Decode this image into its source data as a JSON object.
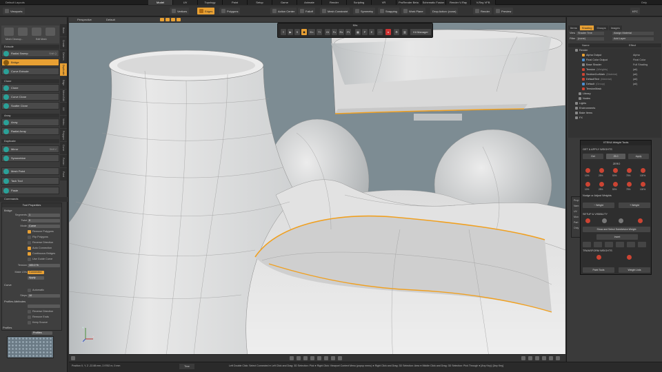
{
  "title": {
    "layout": "Default Layouts",
    "only": "Only"
  },
  "menu_tabs": [
    {
      "label": "Model",
      "active": true
    },
    {
      "label": "UV"
    },
    {
      "label": "Topology"
    },
    {
      "label": "Paint"
    },
    {
      "label": "Setup"
    },
    {
      "label": "Game"
    },
    {
      "label": "Animate"
    },
    {
      "label": "Render"
    },
    {
      "label": "Scripting"
    },
    {
      "label": "VR"
    },
    {
      "label": "ProRender Beta"
    },
    {
      "label": "Schematic Fusion"
    },
    {
      "label": "Render V-Ray"
    },
    {
      "label": "V-Ray VFB"
    }
  ],
  "toolbar": {
    "viewport": "Viewports",
    "vertices": "Vertices",
    "edges": "Edges",
    "polygons": "Polygons",
    "action_center": "Action Center",
    "falloff": "Falloff",
    "mesh_constraint": "Mesh Constraint",
    "symmetry": "Symmetry",
    "snapping": "Snapping",
    "work_plane": "Work Plane",
    "drop_action": "Drop Action: (none)",
    "render": "Render",
    "preview": "Preview",
    "kfc": "KFC"
  },
  "left_panel": {
    "vtabs": [
      "Basic",
      "Create",
      "Deform",
      "Duplicate",
      "Edge",
      "Mesh Edit",
      "UV",
      "Vertex",
      "Polygon",
      "Curve",
      "Fusion",
      "Paint"
    ],
    "mesh_labels": [
      "Mesh Cleanup...",
      "Edit Mesh"
    ],
    "sections": {
      "extrude": "Extrude",
      "clone": "Clone",
      "array": "Array",
      "duplicate": "Duplicate",
      "commands": "Commands"
    },
    "tools": {
      "radial_sweep": "Radial Sweep",
      "bridge": "Bridge",
      "curve_extrude": "Curve Extrude",
      "clone": "Clone",
      "curve_clone": "Curve Clone",
      "scatter_clone": "Scatter Clone",
      "array": "Array",
      "radial_array": "Radial Array",
      "mirror": "Mirror",
      "symmetrize": "Symmetrize",
      "mesh_paint": "Mesh Paint",
      "tack_tool": "Tack Tool",
      "paste": "Paste"
    },
    "hints": {
      "radial_sweep": "Shift Q",
      "mirror": "Shift V"
    }
  },
  "tool_properties": {
    "title": "Tool Properties",
    "section": "Bridge",
    "segments_label": "Segments",
    "segments": "1",
    "twist_label": "Twist",
    "twist": "0",
    "mode_label": "Mode",
    "mode": "Curve",
    "remove_polygons": "Remove Polygons",
    "flip_polygons": "Flip Polygons",
    "reverse_direction": "Reverse Direction",
    "auto_connection": "Auto Connection",
    "continuous_bridges": "Continuous Bridges",
    "use_guide_curve": "Use Guide Curve",
    "tension_label": "Tension",
    "tension": "100.0 %",
    "make_uvs_label": "Make UVs",
    "make_uvs": "Connected",
    "apply": "Apply",
    "curve_section": "Curve",
    "automatic": "Automatic",
    "steps_label": "Steps",
    "steps": "10",
    "profiles_attr": "Profiles Attributes",
    "reverse_direction2": "Reverse Direction",
    "remove_ends": "Remove Ends",
    "keep_source": "Keep Source",
    "profiles": "Profiles",
    "profiles_dd": "Profiles"
  },
  "viewport": {
    "view_name": "Perspective",
    "style": "Default",
    "kit_title": "Kits",
    "kit_buttons": [
      "S",
      "En",
      "TI",
      "GI",
      "Fc",
      "Rx",
      "Pt",
      "P",
      "E"
    ],
    "kit_manager": "Kit Manager",
    "axis": {
      "x": "X",
      "y": "Y",
      "z": "Z"
    }
  },
  "statusbar": {
    "position": "Position X, Y, Z    -22.88 mm, 2.9762 m, 0 mm",
    "time": "Time",
    "hint": "Left Double Click: Select Connected ● Left Click and Drag: 3D Selection: Pick ● Right Click: Viewport Context Menu (popup menu) ● Right Click and Drag: 3D Selection: Area ● Middle Click and Drag: 3D Selection: Pick Through ● [Any Key]: [Any Key]"
  },
  "right_panel": {
    "tabs": [
      "Items",
      "Shading",
      "Groups",
      "Images"
    ],
    "active_tab": "Shading",
    "view_label": "View",
    "view_value": "Shader Tree",
    "assign_material": "Assign Material",
    "filter_label": "Filter",
    "filter_value": "(none)",
    "add_layer": "Add Layer",
    "col_name": "Name",
    "col_effect": "Effect",
    "tree": [
      {
        "name": "Render",
        "effect": "",
        "indent": 0
      },
      {
        "name": "Alpha Output",
        "effect": "Alpha",
        "indent": 2
      },
      {
        "name": "Final Color Output",
        "effect": "Final Color",
        "indent": 2
      },
      {
        "name": "Base Shader",
        "effect": "Full Shading",
        "indent": 2
      },
      {
        "name": "Tension",
        "sub": "(Weights)",
        "effect": "(all)",
        "indent": 2
      },
      {
        "name": "SectionCurMark",
        "sub": "(Material)",
        "effect": "(all)",
        "indent": 2
      },
      {
        "name": "DefaultText",
        "sub": "(Material)",
        "effect": "(all)",
        "indent": 2
      },
      {
        "name": "Default",
        "sub": "(Group)",
        "effect": "(all)",
        "indent": 2
      },
      {
        "name": "TensionMask",
        "effect": "",
        "indent": 2
      },
      {
        "name": "Library",
        "effect": "",
        "indent": 1
      },
      {
        "name": "Nodes",
        "effect": "",
        "indent": 1
      },
      {
        "name": "Lights",
        "effect": "",
        "indent": 0
      },
      {
        "name": "Environments",
        "effect": "",
        "indent": 0
      },
      {
        "name": "Bake Items",
        "effect": "",
        "indent": 0
      },
      {
        "name": "FX",
        "effect": "",
        "indent": 0
      }
    ],
    "prop_stub": [
      "Prop",
      "Nam",
      "UV",
      "Mon",
      "Part",
      "Only"
    ]
  },
  "weight_tools": {
    "title": "XTEKA Weight Tools",
    "get_apply": "GET & APPLY WEIGHTS",
    "get": "Get",
    "value": "25.0",
    "apply": "Apply",
    "zero": "ZERO",
    "percents": [
      "10%",
      "25%",
      "50%",
      "75%",
      "100%"
    ],
    "nudge": "Nudge or Adjust Weights",
    "minus_weight": "Weight",
    "plus_weight": "Weight",
    "setup_vis": "SETUP & VISIBILITY",
    "show_select": "Show and Select Subdivision Weight",
    "invert": "Invert",
    "transform": "TRANSFORM WEIGHTS",
    "paint_tools": "Paint Tools",
    "weight_lists": "Weight Lists"
  },
  "colors": {
    "accent": "#e8a033",
    "viewport_bg": "#7d8c93",
    "selection_edge": "#f0a020"
  }
}
